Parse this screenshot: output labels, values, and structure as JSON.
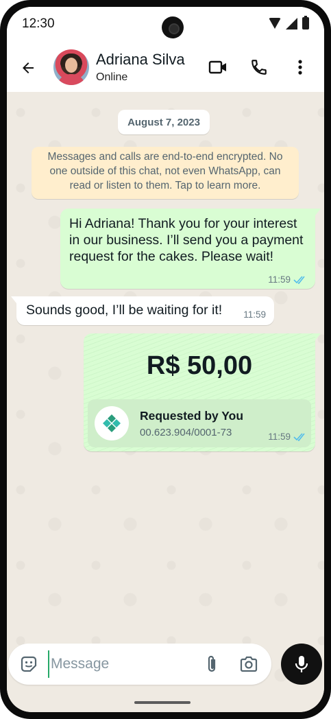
{
  "status_bar": {
    "time": "12:30"
  },
  "header": {
    "contact_name": "Adriana Silva",
    "contact_status": "Online",
    "icons": [
      "back-arrow-icon",
      "video-call-icon",
      "phone-call-icon",
      "more-options-icon"
    ]
  },
  "chat": {
    "date": "August 7, 2023",
    "encryption_notice": "Messages and calls are end-to-end encrypted. No one outside of this chat, not even WhatsApp, can read or listen to them. Tap to learn more.",
    "messages": [
      {
        "direction": "outgoing",
        "text": "Hi Adriana! Thank you for your interest in our business. I’ll send you a payment request for the cakes. Please wait!",
        "time": "11:59",
        "status": "read"
      },
      {
        "direction": "incoming",
        "text": "Sounds good, I’ll be waiting for it!",
        "time": "11:59"
      }
    ],
    "payment_request": {
      "amount": "R$ 50,00",
      "title": "Requested by You",
      "document_id": "00.623.904/0001-73",
      "time": "11:59",
      "status": "read"
    }
  },
  "composer": {
    "placeholder": "Message",
    "value": "",
    "icons": [
      "emoji-sticker-icon",
      "attach-icon",
      "camera-icon",
      "mic-icon"
    ]
  },
  "colors": {
    "outgoing_bubble": "#d9fdd3",
    "incoming_bubble": "#ffffff",
    "chat_background": "#efeae2",
    "read_ticks": "#53bdeb",
    "notice_bubble": "#ffeecd",
    "pix_logo": "#32bcad"
  }
}
